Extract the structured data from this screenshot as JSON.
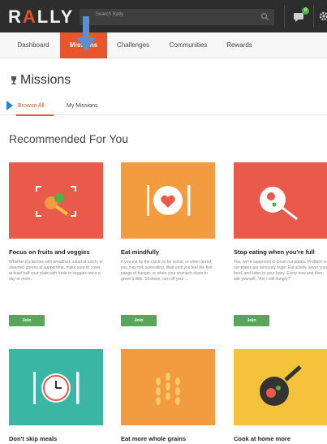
{
  "header": {
    "logo": "RALLY",
    "search_placeholder": "Search Rally",
    "notification_count": "8"
  },
  "nav": {
    "items": [
      "Dashboard",
      "Missions",
      "Challenges",
      "Communities",
      "Rewards"
    ],
    "active": "Missions"
  },
  "page": {
    "title": "Missions",
    "tabs": [
      "Browse All",
      "My Missions"
    ],
    "section_title": "Recommended For You"
  },
  "cards": [
    {
      "title": "Focus on fruits and veggies",
      "description": "Whether it's berries with breakfast, salad at lunch, or steamed greens at suppertime, make sure to cover at least half your plate with fruits or veggies twice a day or more.",
      "join_label": "Join",
      "color": "#ea5a4a",
      "icon": "fruit-veggie-icon"
    },
    {
      "title": "Eat mindfully",
      "description": "If you eat by the clock, to be social, or when bored, you may risk overeating. Wait until you feel the first pangs of hunger, or when your stomach starts to growl a little. Sit down, turn off your ...",
      "join_label": "Join",
      "color": "#f39b3f",
      "icon": "plate-heart-icon"
    },
    {
      "title": "Stop eating when you're full",
      "description": "Yes, we're supposed to clean our plates. Problem is, our plates are seriously huge! Eat slowly, savor your food, and listen to your body. Every now and then, ask yourself, \"Am I still hungry?\"",
      "join_label": "Join",
      "color": "#ea5a4a",
      "icon": "drumstick-icon"
    },
    {
      "title": "Don't skip meals",
      "color": "#3ab6a5",
      "icon": "clock-utensils-icon"
    },
    {
      "title": "Eat more whole grains",
      "color": "#f39b3f",
      "icon": "wheat-icon"
    },
    {
      "title": "Cook at home more",
      "color": "#f5c33b",
      "icon": "frying-pan-icon"
    }
  ]
}
